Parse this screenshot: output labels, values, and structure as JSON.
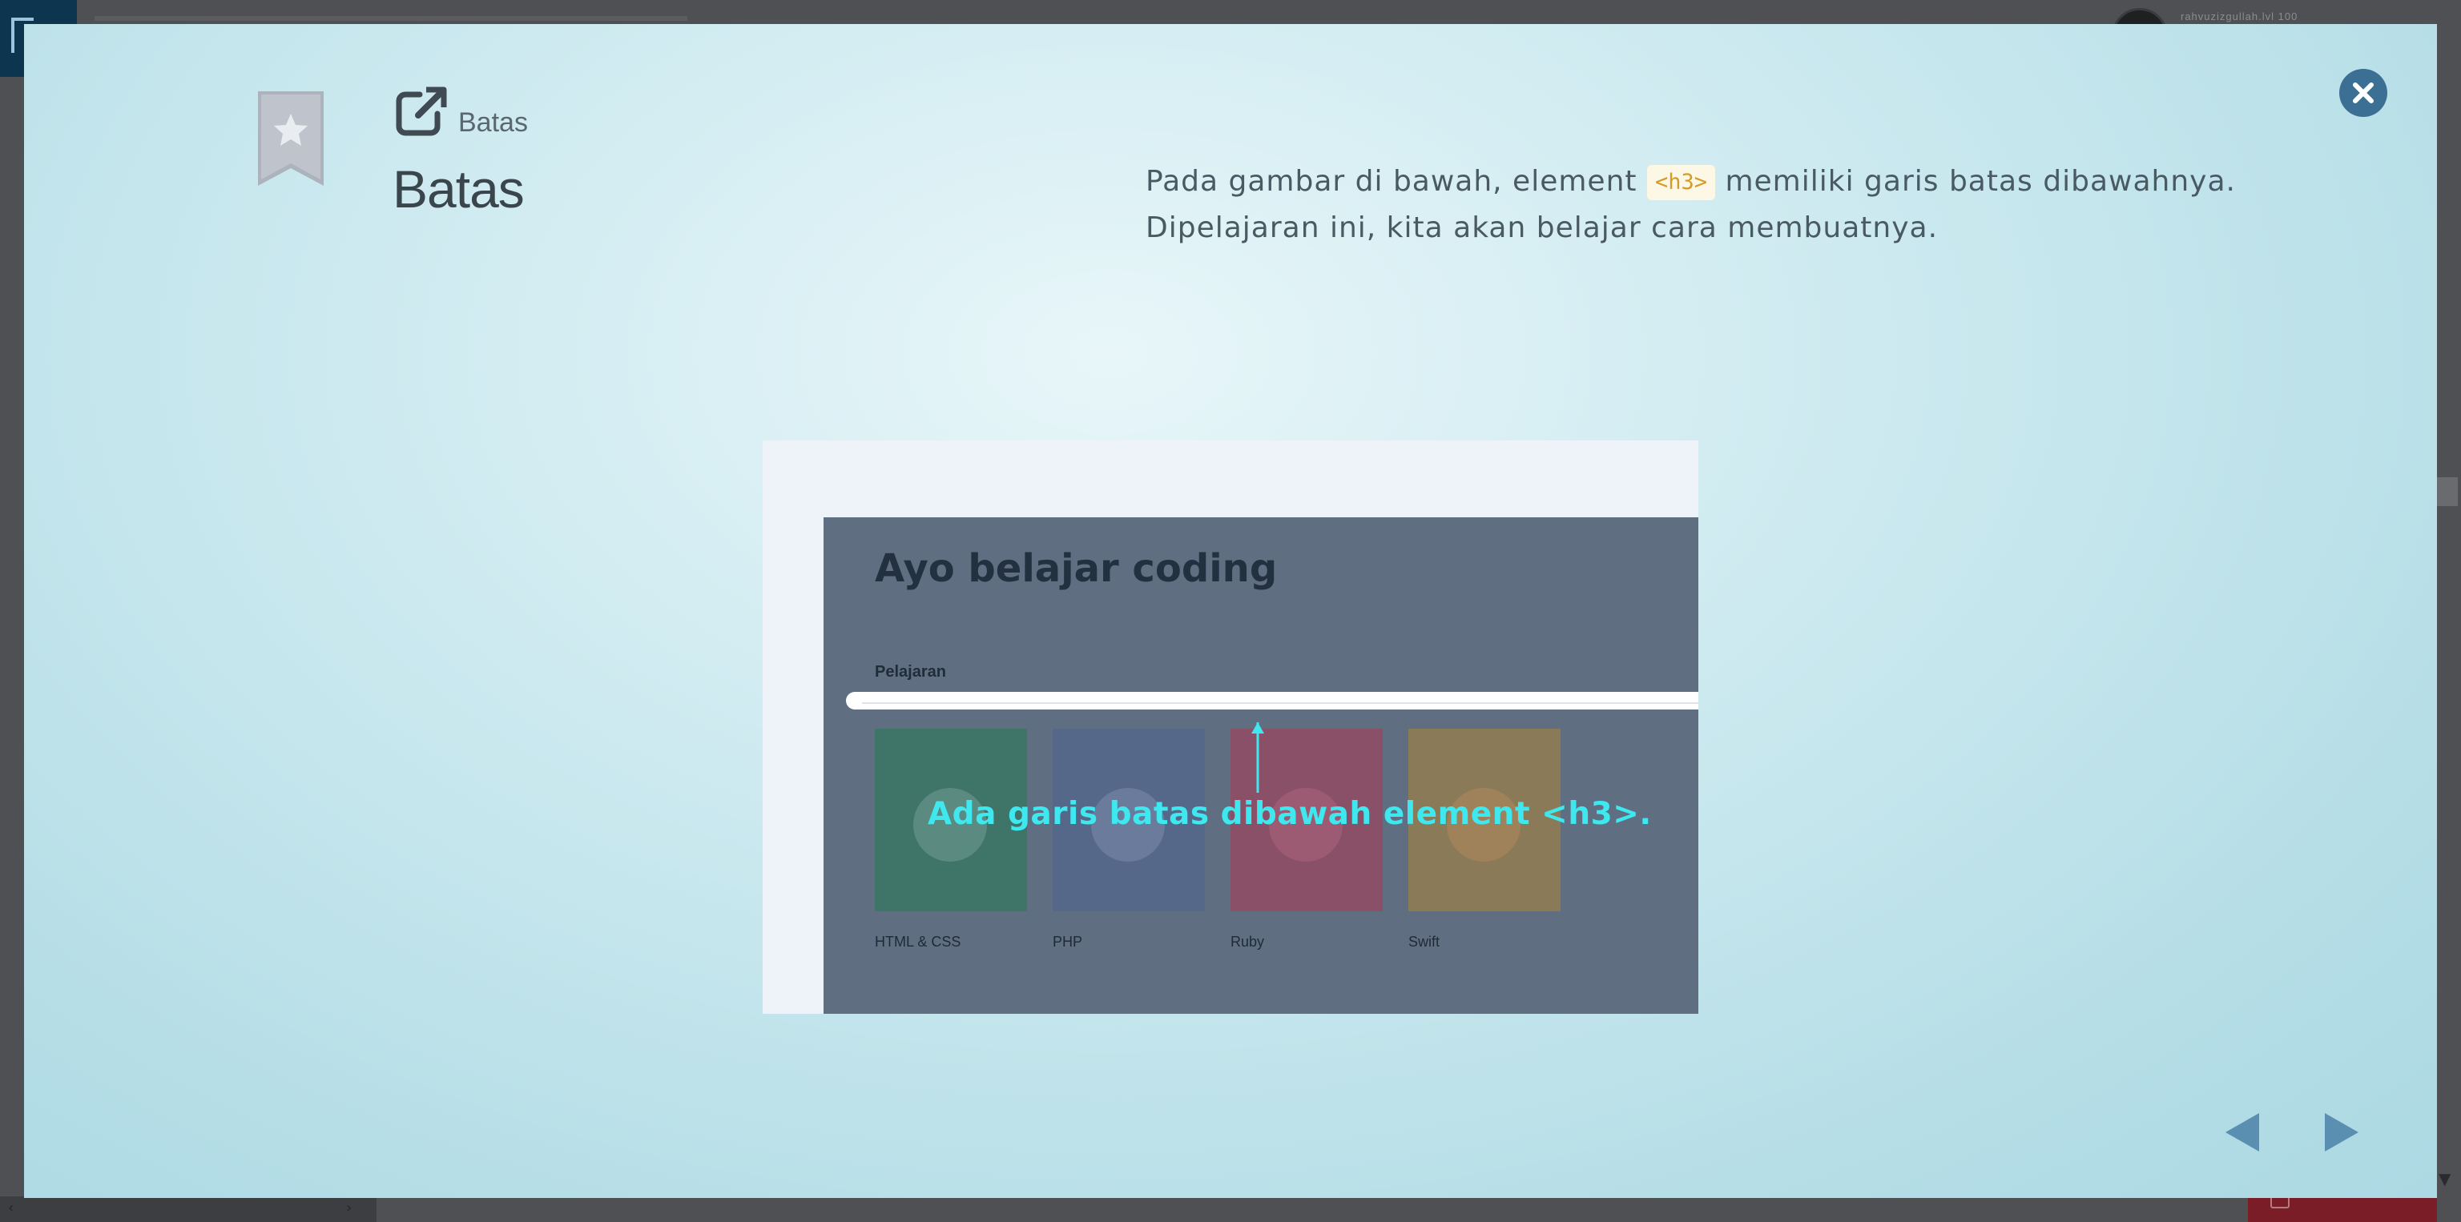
{
  "background": {
    "username": "rahvuzizgullah.lvl 100"
  },
  "lesson": {
    "breadcrumb": "Batas",
    "title": "Batas",
    "description": {
      "part1": "Pada gambar di bawah, element",
      "code": "<h3>",
      "part2": "memiliki garis batas dibawahnya.",
      "line2": "Dipelajaran ini, kita akan belajar cara membuatnya."
    }
  },
  "illustration": {
    "heading": "Ayo belajar coding",
    "subheading": "Pelajaran",
    "annotation": "Ada garis batas dibawah element <h3>.",
    "cards": [
      {
        "label": "HTML & CSS",
        "color": "#3f7468",
        "icon_color": "#5b8a80"
      },
      {
        "label": "PHP",
        "color": "#55688a",
        "icon_color": "#6a7b9c"
      },
      {
        "label": "Ruby",
        "color": "#8a5068",
        "icon_color": "#9c5b72"
      },
      {
        "label": "Swift",
        "color": "#8a7a58",
        "icon_color": "#a0825a"
      }
    ]
  },
  "colors": {
    "accent": "#3c6f94",
    "annotation": "#3fe7ef",
    "code_text": "#d39b2a"
  }
}
